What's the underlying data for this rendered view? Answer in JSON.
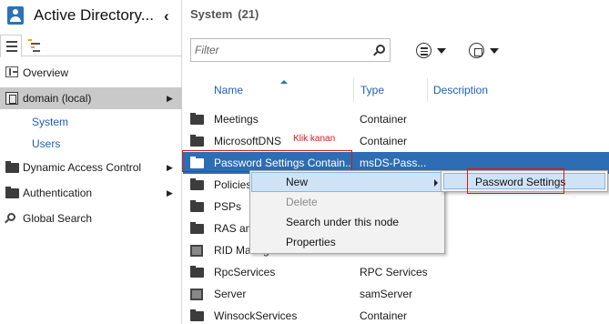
{
  "app": {
    "title": "Active Directory...",
    "collapse_glyph": "‹"
  },
  "left_nav": {
    "items": [
      {
        "label": "Overview",
        "icon": "overview-icon"
      },
      {
        "label": "domain (local)",
        "icon": "domain-icon",
        "selected": true
      },
      {
        "label": "System",
        "child": true
      },
      {
        "label": "Users",
        "child": true
      },
      {
        "label": "Dynamic Access Control",
        "icon": "folder-icon"
      },
      {
        "label": "Authentication",
        "icon": "folder-icon"
      },
      {
        "label": "Global Search",
        "icon": "search-icon"
      }
    ]
  },
  "main": {
    "breadcrumb": "System",
    "count": "(21)",
    "filter_placeholder": "Filter",
    "columns": {
      "name": "Name",
      "type": "Type",
      "description": "Description"
    },
    "rows": [
      {
        "name": "Meetings",
        "type": "Container",
        "icon": "folder-icon"
      },
      {
        "name": "MicrosoftDNS",
        "type": "Container",
        "icon": "folder-icon"
      },
      {
        "name": "Password Settings Contain...",
        "type": "msDS-Pass...",
        "icon": "folder-icon",
        "selected": true
      },
      {
        "name": "Policies",
        "type": "",
        "icon": "folder-icon"
      },
      {
        "name": "PSPs",
        "type": "",
        "icon": "folder-icon"
      },
      {
        "name": "RAS and",
        "type": "",
        "icon": "folder-icon"
      },
      {
        "name": "RID Manager",
        "type": "",
        "icon": "server-icon"
      },
      {
        "name": "RpcServices",
        "type": "RPC Services",
        "icon": "folder-icon"
      },
      {
        "name": "Server",
        "type": "samServer",
        "icon": "server-icon"
      },
      {
        "name": "WinsockServices",
        "type": "Container",
        "icon": "folder-icon"
      }
    ]
  },
  "annotation": {
    "label": "Klik kanan",
    "color": "#d11a1a"
  },
  "context_menu": {
    "items": [
      {
        "label": "New",
        "has_submenu": true,
        "hover": true
      },
      {
        "label": "Delete",
        "disabled": true
      },
      {
        "label": "Search under this node"
      },
      {
        "label": "Properties"
      }
    ]
  },
  "submenu": {
    "items": [
      {
        "label": "Password Settings"
      }
    ]
  },
  "colors": {
    "selection": "#2d6db3",
    "link_blue": "#1f5fb0",
    "menu_hover": "#cfe3f7"
  }
}
